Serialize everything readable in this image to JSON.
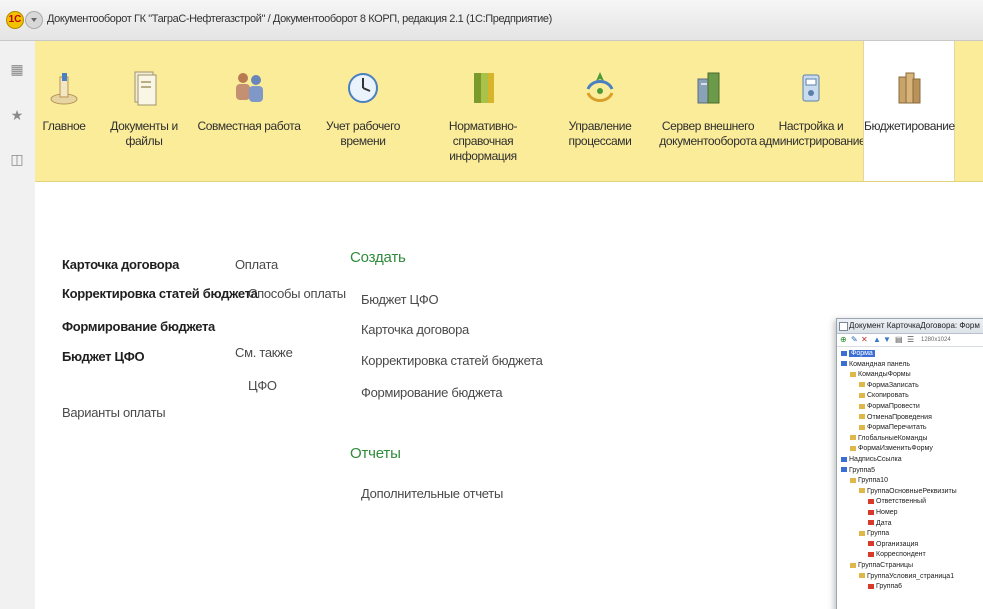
{
  "window": {
    "title": "Документооборот ГК \"ТаграС-Нефтегазстрой\" / Документооборот 8 КОРП, редакция 2.1 (1С:Предприятие)"
  },
  "sections": [
    {
      "label": "Главное",
      "icon": "home-icon"
    },
    {
      "label": "Документы и файлы",
      "icon": "documents-icon"
    },
    {
      "label": "Совместная работа",
      "icon": "people-icon"
    },
    {
      "label": "Учет рабочего времени",
      "icon": "clock-icon"
    },
    {
      "label": "Нормативно-справочная информация",
      "icon": "binders-icon"
    },
    {
      "label": "Управление процессами",
      "icon": "process-icon"
    },
    {
      "label": "Сервер внешнего документооборота",
      "icon": "server-icon"
    },
    {
      "label": "Настройка и администрирование",
      "icon": "settings-icon"
    },
    {
      "label": "Бюджетирование",
      "icon": "budget-icon"
    }
  ],
  "colors": {
    "section_bar": "#fbec9a",
    "group_title": "#2e8b3a",
    "accent": "#3b6fd6"
  },
  "nav": {
    "col1": [
      "Карточка договора",
      "Корректировка статей бюджета",
      "Формирование бюджета",
      "Бюджет ЦФО"
    ],
    "col1_extra": "Варианты оплаты",
    "col2": [
      "Оплата",
      "Способы оплаты"
    ],
    "see_also": "См. также",
    "see_also_items": [
      "ЦФО"
    ]
  },
  "create": {
    "title": "Создать",
    "items": [
      "Бюджет ЦФО",
      "Карточка договора",
      "Корректировка статей бюджета",
      "Формирование бюджета"
    ]
  },
  "reports": {
    "title": "Отчеты",
    "items": [
      "Дополнительные отчеты"
    ]
  },
  "panel": {
    "title": "Документ КарточкаДоговора: Форм",
    "toolbar_size": "1280x1024",
    "tree": [
      {
        "label": "Форма",
        "level": 0,
        "selected": true
      },
      {
        "label": "Командная панель",
        "level": 0
      },
      {
        "label": "КомандыФормы",
        "level": 1
      },
      {
        "label": "ФормаЗаписать",
        "level": 2
      },
      {
        "label": "Скопировать",
        "level": 2
      },
      {
        "label": "ФормаПровести",
        "level": 2
      },
      {
        "label": "ОтменаПроведения",
        "level": 2
      },
      {
        "label": "ФормаПеречитать",
        "level": 2
      },
      {
        "label": "ГлобальныеКоманды",
        "level": 1
      },
      {
        "label": "ФормаИзменитьФорму",
        "level": 1
      },
      {
        "label": "НадписьСсылка",
        "level": 0
      },
      {
        "label": "Группа5",
        "level": 0
      },
      {
        "label": "Группа10",
        "level": 1
      },
      {
        "label": "ГруппаОсновныеРеквизиты",
        "level": 2
      },
      {
        "label": "Ответственный",
        "level": 3
      },
      {
        "label": "Номер",
        "level": 3
      },
      {
        "label": "Дата",
        "level": 3
      },
      {
        "label": "Группа",
        "level": 2
      },
      {
        "label": "Организация",
        "level": 3
      },
      {
        "label": "Корреспондент",
        "level": 3
      },
      {
        "label": "ГруппаСтраницы",
        "level": 1
      },
      {
        "label": "ГруппаУсловия_страница1",
        "level": 2
      },
      {
        "label": "Группа6",
        "level": 3
      }
    ]
  }
}
